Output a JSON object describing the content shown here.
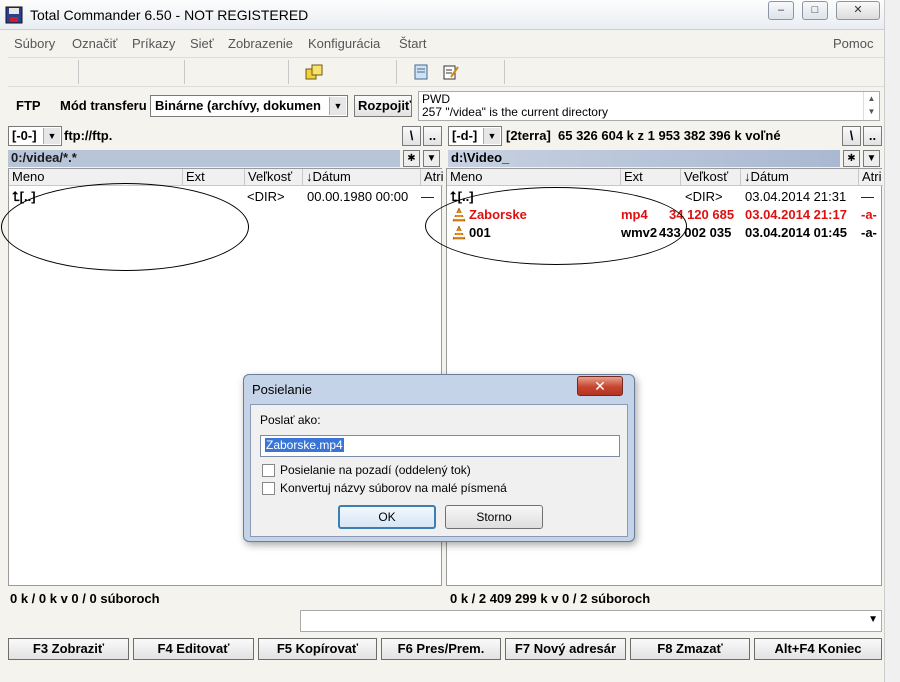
{
  "window": {
    "title": "Total Commander 6.50 - NOT REGISTERED",
    "minimize_glyph": "–",
    "maximize_glyph": "□",
    "close_glyph": "✕"
  },
  "menu": {
    "items": [
      "Súbory",
      "Označiť",
      "Príkazy",
      "Sieť",
      "Zobrazenie",
      "Konfigurácia",
      "Štart"
    ],
    "help": "Pomoc"
  },
  "ftpbar": {
    "ftp_label": "FTP",
    "transfer_label": "Mód transferu",
    "transfer_value": "Binárne (archívy, dokumen",
    "disconnect_label": "Rozpojiť",
    "log_lines": [
      "PWD",
      "257 \"/videa\" is the current directory"
    ]
  },
  "left": {
    "drive": "[-0-]",
    "drive_info": "ftp://ftp.",
    "path": "0:/videa/*.*",
    "columns": [
      "Meno",
      "Ext",
      "Veľkosť",
      "↓Dátum",
      "Atri"
    ],
    "rows": [
      {
        "name": "[..]",
        "ext": "",
        "size": "<DIR>",
        "date": "00.00.1980 00:00",
        "attr": "—"
      }
    ],
    "status": "0 k / 0 k v 0 / 0 súboroch"
  },
  "right": {
    "drive": "[-d-]",
    "drive_label": "[2terra]",
    "drive_info": "65 326 604 k z 1 953 382 396 k voľné",
    "path": "d:\\Video_",
    "columns": [
      "Meno",
      "Ext",
      "Veľkosť",
      "↓Dátum",
      "Atri"
    ],
    "rows": [
      {
        "name": "[..]",
        "ext": "",
        "size": "<DIR>",
        "date": "03.04.2014 21:31",
        "attr": "—"
      },
      {
        "name": "Zaborske",
        "ext": "mp4",
        "size": "34 120 685",
        "date": "03.04.2014 21:17",
        "attr": "-a-"
      },
      {
        "name": "001",
        "ext": "wmv2",
        "size": "433 002 035",
        "date": "03.04.2014 01:45",
        "attr": "-a-"
      }
    ],
    "status": "0 k / 2 409 299 k v 0 / 2 súboroch"
  },
  "panel_buttons": {
    "root": "\\",
    "parent": "..",
    "star": "✱",
    "down": "▼"
  },
  "fkeys": [
    "F3 Zobraziť",
    "F4 Editovať",
    "F5 Kopírovať",
    "F6 Pres/Prem.",
    "F7 Nový adresár",
    "F8 Zmazať",
    "Alt+F4 Koniec"
  ],
  "dialog": {
    "title": "Posielanie",
    "close_glyph": "✕",
    "label": "Poslať ako:",
    "input_value": "Zaborske.mp4",
    "checkbox1": "Posielanie na pozadí (oddelený tok)",
    "checkbox2": "Konvertuj názvy súborov na malé písmená",
    "checkbox1_checked": false,
    "checkbox2_checked": false,
    "ok": "OK",
    "cancel": "Storno"
  },
  "colors": {
    "red_file": "#e01010",
    "path_active": "#aab8d1",
    "selection": "#3875d7"
  }
}
